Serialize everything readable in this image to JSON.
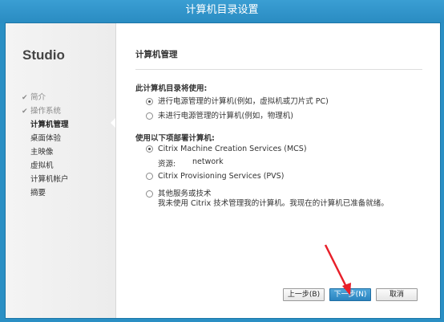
{
  "window": {
    "title": "计算机目录设置"
  },
  "sidebar": {
    "brand": "Studio",
    "items": [
      {
        "label": "简介",
        "state": "done"
      },
      {
        "label": "操作系统",
        "state": "done"
      },
      {
        "label": "计算机管理",
        "state": "active"
      },
      {
        "label": "桌面体验",
        "state": "pending"
      },
      {
        "label": "主映像",
        "state": "pending"
      },
      {
        "label": "虚拟机",
        "state": "pending"
      },
      {
        "label": "计算机帐户",
        "state": "pending"
      },
      {
        "label": "摘要",
        "state": "pending"
      }
    ]
  },
  "main": {
    "title": "计算机管理",
    "group1": {
      "label": "此计算机目录将使用:",
      "options": [
        {
          "label": "进行电源管理的计算机(例如，虚拟机或刀片式 PC)",
          "selected": true
        },
        {
          "label": "未进行电源管理的计算机(例如，物理机)",
          "selected": false
        }
      ]
    },
    "group2": {
      "label": "使用以下项部署计算机:",
      "options": [
        {
          "label": "Citrix Machine Creation Services (MCS)",
          "selected": true
        },
        {
          "label": "Citrix Provisioning Services (PVS)",
          "selected": false
        },
        {
          "label": "其他服务或技术",
          "selected": false
        }
      ],
      "resource_label": "资源:",
      "resource_value": "network",
      "other_description": "我未使用 Citrix 技术管理我的计算机。我现在的计算机已准备就绪。"
    }
  },
  "footer": {
    "back_label": "上一步(B)",
    "next_label": "下一步(N)",
    "cancel_label": "取消"
  },
  "annotation": {
    "arrow_color": "#e8202a"
  }
}
